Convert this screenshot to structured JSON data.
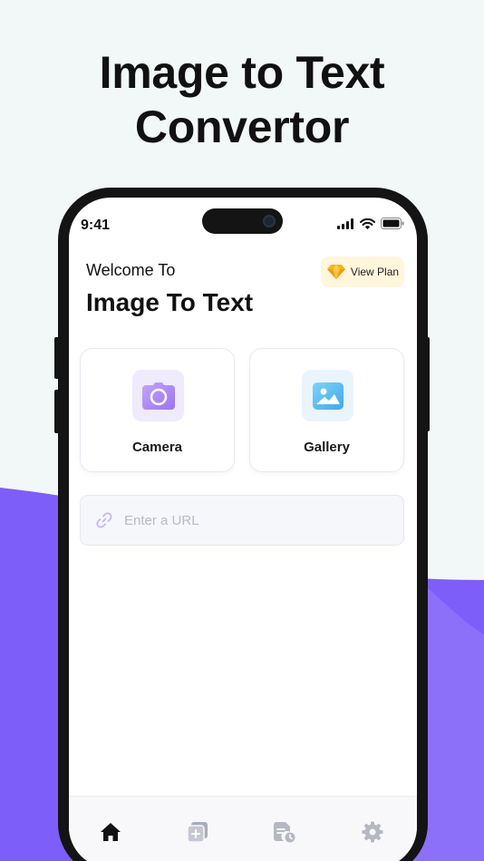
{
  "headline": {
    "line1": "Image to Text",
    "line2": "Convertor"
  },
  "colors": {
    "accent_purple": "#7e5ef8",
    "background": "#f2f7f7",
    "plan_badge": "#fff6dc"
  },
  "status_bar": {
    "time": "9:41",
    "icons": [
      "signal-icon",
      "wifi-icon",
      "battery-icon"
    ]
  },
  "header": {
    "welcome": "Welcome To",
    "title": "Image To Text",
    "plan_button": "View Plan",
    "plan_icon": "diamond-icon"
  },
  "cards": [
    {
      "label": "Camera",
      "icon": "camera-icon"
    },
    {
      "label": "Gallery",
      "icon": "image-icon"
    }
  ],
  "url_input": {
    "placeholder": "Enter a URL",
    "value": "",
    "icon": "link-icon"
  },
  "tabs": [
    {
      "name": "home",
      "icon": "home-icon",
      "active": true
    },
    {
      "name": "new-document",
      "icon": "document-add-icon",
      "active": false
    },
    {
      "name": "history",
      "icon": "document-history-icon",
      "active": false
    },
    {
      "name": "settings",
      "icon": "gear-icon",
      "active": false
    }
  ]
}
